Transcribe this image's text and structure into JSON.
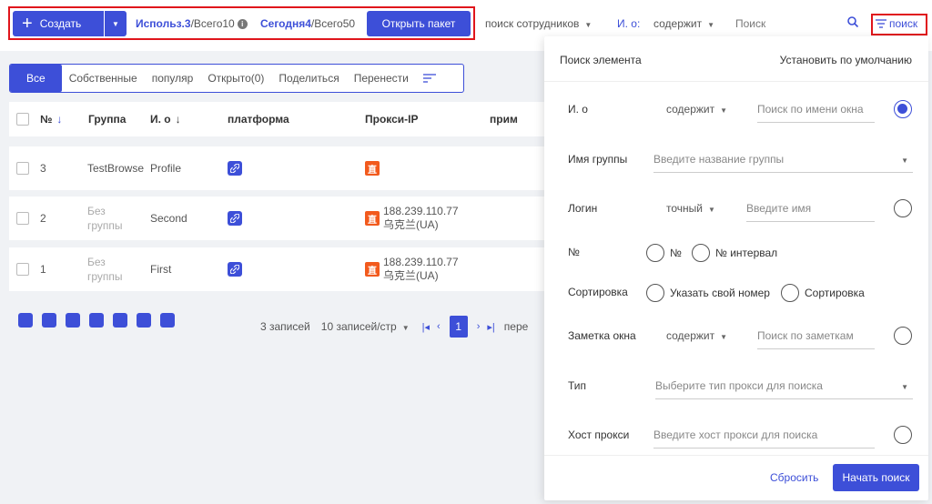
{
  "toolbar": {
    "create_label": "Создать",
    "used_label": "Использ.3",
    "used_total": "/Всего10",
    "today_label": "Сегодня4",
    "today_total": "/Всего50",
    "open_package": "Открыть пакет",
    "employee_search": "поиск сотрудников",
    "field": "И. о:",
    "condition": "содержит",
    "search_placeholder": "Поиск",
    "filter_label": "поиск"
  },
  "tabs": [
    "Все",
    "Собственные",
    "популяр",
    "Открыто(0)",
    "Поделиться",
    "Перенести"
  ],
  "table": {
    "headers": {
      "no": "№",
      "group": "Группа",
      "name": "И. о",
      "platform": "платформа",
      "proxy": "Прокси-IP",
      "note": "прим"
    },
    "rows": [
      {
        "no": "3",
        "group": "TestBrowse",
        "group_muted": false,
        "name": "Profile",
        "proxy_ip": "",
        "proxy_loc": ""
      },
      {
        "no": "2",
        "group": "Без группы",
        "group_muted": true,
        "name": "Second",
        "proxy_ip": "188.239.110.77",
        "proxy_loc": "乌克兰(UA)"
      },
      {
        "no": "1",
        "group": "Без группы",
        "group_muted": true,
        "name": "First",
        "proxy_ip": "188.239.110.77",
        "proxy_loc": "乌克兰(UA)"
      }
    ],
    "proxy_badge": "直"
  },
  "pager": {
    "records": "3 записей",
    "per_page": "10 записей/стр",
    "current": "1",
    "tail": "пере"
  },
  "panel": {
    "title": "Поиск элемента",
    "set_default": "Установить по умолчанию",
    "fields": {
      "name_label": "И. о",
      "name_op": "содержит",
      "name_placeholder": "Поиск по имени окна",
      "group_label": "Имя группы",
      "group_placeholder": "Введите название группы",
      "login_label": "Логин",
      "login_op": "точный",
      "login_placeholder": "Введите имя",
      "no_label": "№",
      "no_opt1": "№",
      "no_opt2": "№ интервал",
      "sort_label": "Сортировка",
      "sort_opt1": "Указать свой номер",
      "sort_opt2": "Сортировка",
      "note_label": "Заметка окна",
      "note_op": "содержит",
      "note_placeholder": "Поиск по заметкам",
      "type_label": "Тип",
      "type_placeholder": "Выберите тип прокси для поиска",
      "host_label": "Хост прокси",
      "host_placeholder": "Введите хост прокси для поиска"
    },
    "reset": "Сбросить",
    "start": "Начать поиск"
  },
  "colors": {
    "accent": "#3d4fd8",
    "highlight": "#e0151c",
    "proxy": "#f25a1d"
  }
}
